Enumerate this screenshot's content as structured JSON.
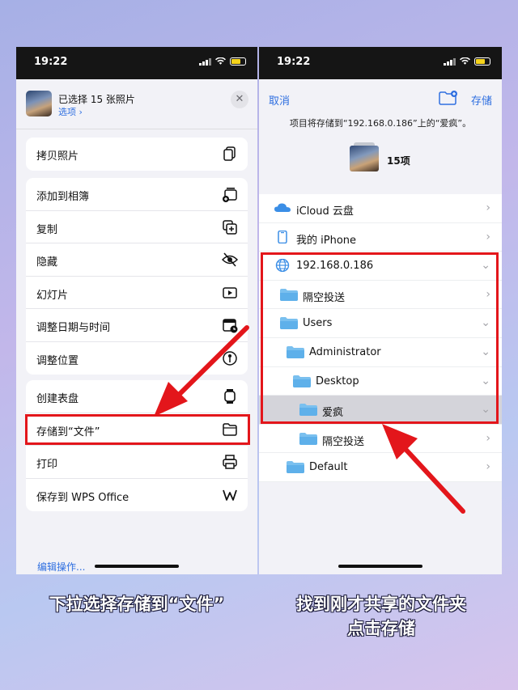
{
  "status_time": "19:22",
  "colors": {
    "accent": "#2f6fe0",
    "highlight_red": "#e3161b"
  },
  "left": {
    "header": {
      "title": "已选择 15 张照片",
      "options": "选项"
    },
    "close_icon": "close-icon",
    "groups": [
      [
        {
          "label": "拷贝照片",
          "icon": "copy-photos-icon"
        }
      ],
      [
        {
          "label": "添加到相簿",
          "icon": "add-album-icon"
        },
        {
          "label": "复制",
          "icon": "duplicate-icon"
        },
        {
          "label": "隐藏",
          "icon": "eye-slash-icon"
        },
        {
          "label": "幻灯片",
          "icon": "play-icon"
        },
        {
          "label": "调整日期与时间",
          "icon": "calendar-icon"
        },
        {
          "label": "调整位置",
          "icon": "location-icon"
        }
      ],
      [
        {
          "label": "创建表盘",
          "icon": "watch-icon"
        },
        {
          "label": "存储到“文件”",
          "icon": "folder-icon"
        },
        {
          "label": "打印",
          "icon": "printer-icon"
        },
        {
          "label": "保存到 WPS Office",
          "icon": "wps-icon"
        }
      ]
    ],
    "edit_actions": "编辑操作..."
  },
  "right": {
    "cancel": "取消",
    "save": "存储",
    "notice": "项目将存储到“192.168.0.186”上的“爱疯”。",
    "count": "15项",
    "locations": [
      {
        "label": "iCloud 云盘",
        "icon": "cloud-icon",
        "indent": 0,
        "chevron": "›"
      },
      {
        "label": "我的 iPhone",
        "icon": "iphone-icon",
        "indent": 0,
        "chevron": "›"
      },
      {
        "label": "192.168.0.186",
        "icon": "globe-icon",
        "indent": 0,
        "chevron": "⌄"
      },
      {
        "label": "隔空投送",
        "icon": "folder-icon",
        "indent": 1,
        "chevron": "›"
      },
      {
        "label": "Users",
        "icon": "folder-icon",
        "indent": 1,
        "chevron": "⌄"
      },
      {
        "label": "Administrator",
        "icon": "folder-icon",
        "indent": 2,
        "chevron": "⌄"
      },
      {
        "label": "Desktop",
        "icon": "folder-icon",
        "indent": 3,
        "chevron": "⌄"
      },
      {
        "label": "爱疯",
        "icon": "folder-icon",
        "indent": 4,
        "chevron": "⌄",
        "selected": true
      },
      {
        "label": "隔空投送",
        "icon": "folder-icon",
        "indent": 4,
        "chevron": "›"
      },
      {
        "label": "Default",
        "icon": "folder-icon",
        "indent": 2,
        "chevron": "›"
      }
    ]
  },
  "captions": {
    "left": "下拉选择存储到“文件”",
    "right_line1": "找到刚才共享的文件夹",
    "right_line2": "点击存储"
  }
}
